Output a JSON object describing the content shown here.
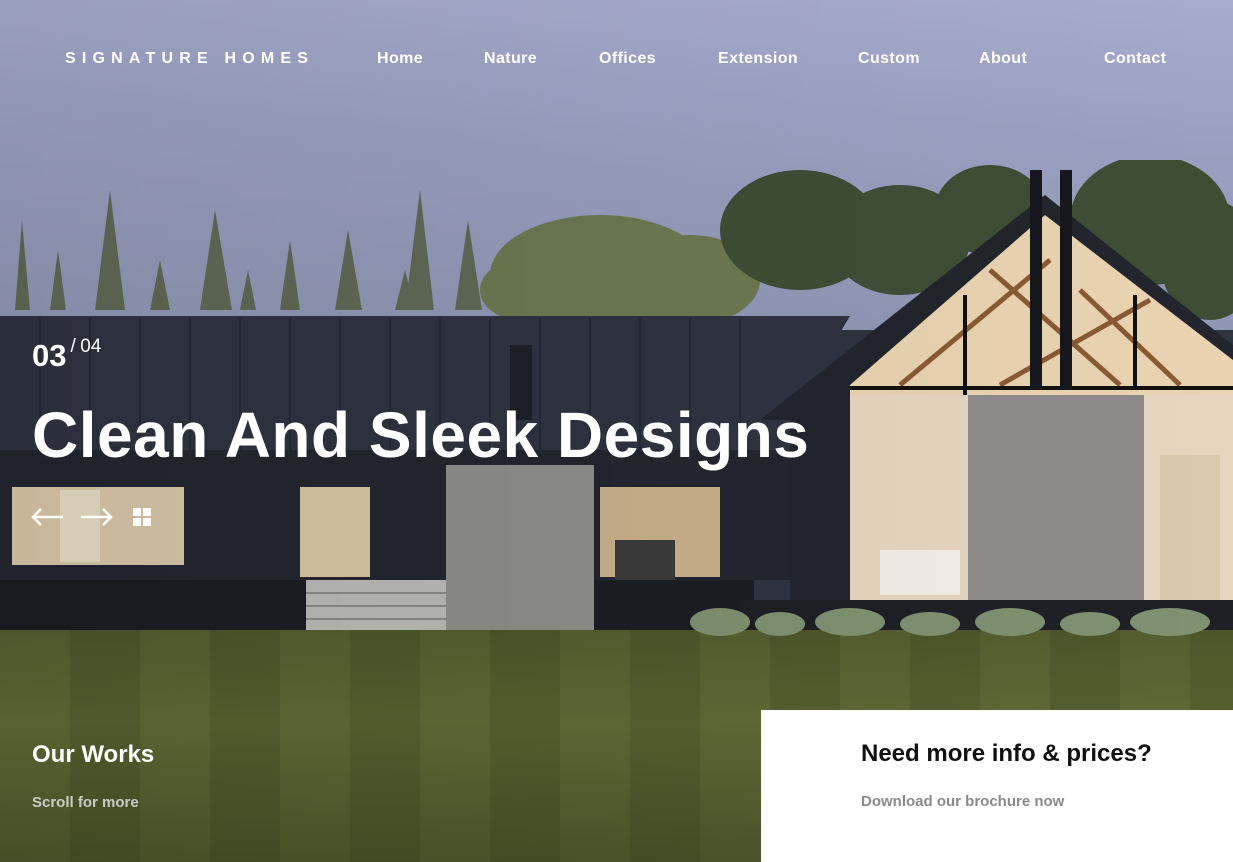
{
  "brand": "SIGNATURE HOMES",
  "nav": {
    "items": [
      {
        "label": "Home"
      },
      {
        "label": "Nature"
      },
      {
        "label": "Offices"
      },
      {
        "label": "Extension"
      },
      {
        "label": "Custom"
      },
      {
        "label": "About"
      },
      {
        "label": "Contact"
      }
    ]
  },
  "hero": {
    "current_slide": "03",
    "separator": "/",
    "total_slides": "04",
    "headline": "Clean And Sleek Designs",
    "controls": {
      "prev_icon": "arrow-left-icon",
      "next_icon": "arrow-right-icon",
      "grid_icon": "grid-icon"
    }
  },
  "works": {
    "title": "Our Works",
    "subtitle": "Scroll for more"
  },
  "info_card": {
    "title": "Need more info & prices?",
    "link": "Download our brochure now"
  },
  "colors": {
    "text_on_image": "#ffffff",
    "card_background": "#ffffff",
    "card_title": "#111111",
    "card_link": "#8a8a8a"
  }
}
